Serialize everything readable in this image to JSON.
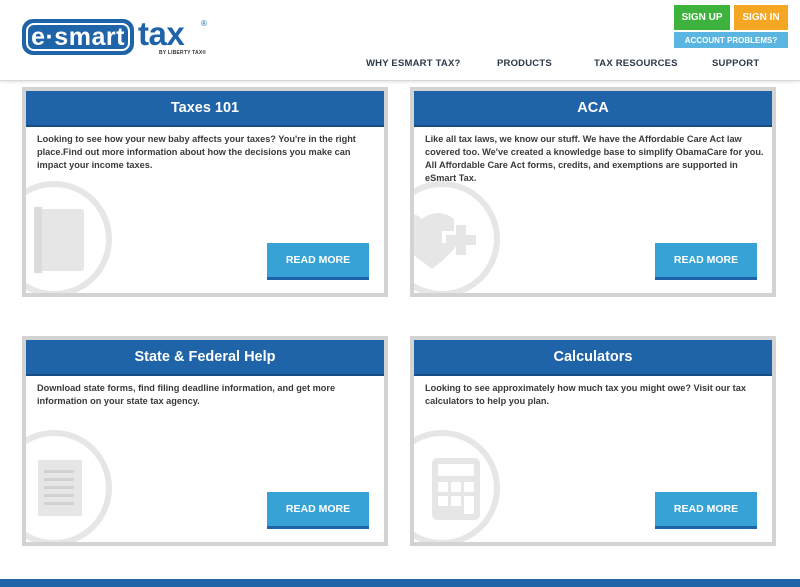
{
  "header": {
    "logo": {
      "pill_text": "e·smart",
      "tax_text": "tax",
      "registered": "®",
      "sub_text": "BY LIBERTY TAX®"
    },
    "signup_label": "SIGN UP",
    "signin_label": "SIGN IN",
    "account_label": "ACCOUNT PROBLEMS?",
    "nav": [
      {
        "label": "WHY ESMART TAX?"
      },
      {
        "label": "PRODUCTS"
      },
      {
        "label": "TAX RESOURCES"
      },
      {
        "label": "SUPPORT"
      }
    ]
  },
  "cards": [
    {
      "title": "Taxes 101",
      "text": "Looking to see how your new baby affects your taxes? You're in the right place.Find out more information about how the decisions you make can impact your income taxes.",
      "button": "READ MORE",
      "icon": "document-icon"
    },
    {
      "title": "ACA",
      "text": "Like all tax laws, we know our stuff. We have the Affordable Care Act law covered too. We've created a knowledge base to simplify ObamaCare for you. All Affordable Care Act forms, credits, and exemptions are supported in eSmart Tax.",
      "button": "READ MORE",
      "icon": "heart-plus-icon"
    },
    {
      "title": "State & Federal Help",
      "text": "Download state forms, find filing deadline information, and get more information on your state tax agency.",
      "button": "READ MORE",
      "icon": "forms-icon"
    },
    {
      "title": "Calculators",
      "text": "Looking to see approximately how much tax you might owe? Visit our tax calculators to help you plan.",
      "button": "READ MORE",
      "icon": "calculator-icon"
    }
  ],
  "colors": {
    "brand_blue": "#1f63a8",
    "button_blue": "#36a2d6",
    "signup_green": "#3db33d",
    "signin_orange": "#f5a623",
    "account_blue": "#5ab6e0"
  }
}
